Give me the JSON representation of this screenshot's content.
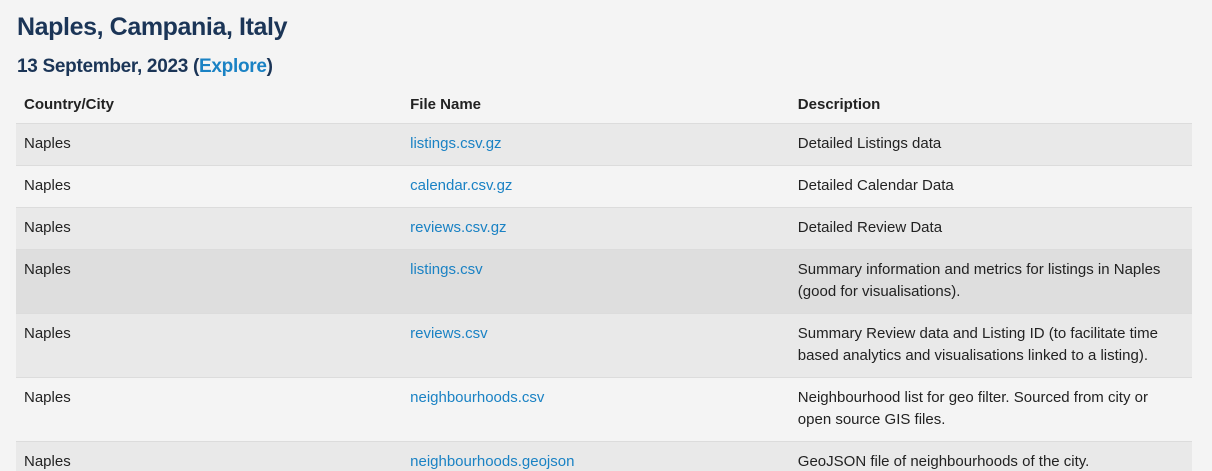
{
  "header": {
    "title": "Naples, Campania, Italy",
    "date": "13 September, 2023",
    "open_paren": "(",
    "explore_link": "Explore",
    "close_paren": ")"
  },
  "table": {
    "columns": [
      "Country/City",
      "File Name",
      "Description"
    ],
    "rows": [
      {
        "city": "Naples",
        "file": "listings.csv.gz",
        "description": "Detailed Listings data"
      },
      {
        "city": "Naples",
        "file": "calendar.csv.gz",
        "description": "Detailed Calendar Data"
      },
      {
        "city": "Naples",
        "file": "reviews.csv.gz",
        "description": "Detailed Review Data"
      },
      {
        "city": "Naples",
        "file": "listings.csv",
        "description": "Summary information and metrics for listings in Naples (good for visualisations)."
      },
      {
        "city": "Naples",
        "file": "reviews.csv",
        "description": "Summary Review data and Listing ID (to facilitate time based analytics and visualisations linked to a listing)."
      },
      {
        "city": "Naples",
        "file": "neighbourhoods.csv",
        "description": "Neighbourhood list for geo filter. Sourced from city or open source GIS files."
      },
      {
        "city": "Naples",
        "file": "neighbourhoods.geojson",
        "description": "GeoJSON file of neighbourhoods of the city."
      }
    ]
  },
  "colors": {
    "heading": "#1b3557",
    "link": "#1a82c4",
    "row_alt": "#e9e9e9",
    "row_hover": "#dedede"
  }
}
